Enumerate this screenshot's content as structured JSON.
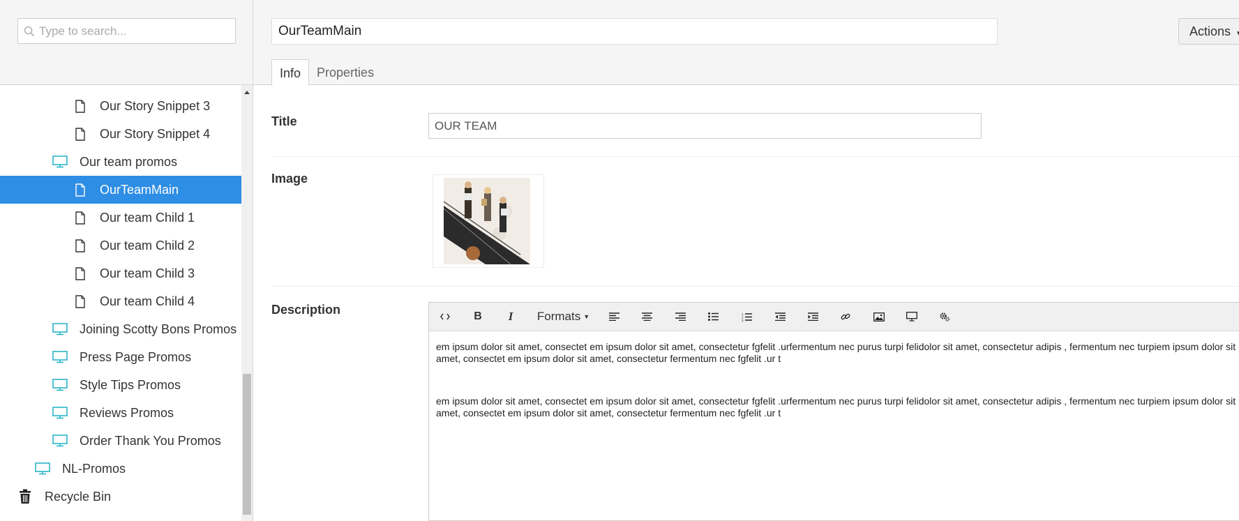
{
  "search": {
    "placeholder": "Type to search..."
  },
  "tree": [
    {
      "label": "Our Story Snippet 3",
      "icon": "document-icon",
      "level": 2
    },
    {
      "label": "Our Story Snippet 4",
      "icon": "document-icon",
      "level": 2
    },
    {
      "label": "Our team promos",
      "icon": "monitor-icon",
      "level": 1
    },
    {
      "label": "OurTeamMain",
      "icon": "document-icon",
      "level": 2,
      "selected": true
    },
    {
      "label": "Our team Child 1",
      "icon": "document-icon",
      "level": 2
    },
    {
      "label": "Our team Child 2",
      "icon": "document-icon",
      "level": 2
    },
    {
      "label": "Our team Child 3",
      "icon": "document-icon",
      "level": 2
    },
    {
      "label": "Our team Child 4",
      "icon": "document-icon",
      "level": 2
    },
    {
      "label": "Joining Scotty Bons Promos",
      "icon": "monitor-icon",
      "level": 1
    },
    {
      "label": "Press Page Promos",
      "icon": "monitor-icon",
      "level": 1
    },
    {
      "label": "Style Tips Promos",
      "icon": "monitor-icon",
      "level": 1
    },
    {
      "label": "Reviews Promos",
      "icon": "monitor-icon",
      "level": 1
    },
    {
      "label": "Order Thank You Promos",
      "icon": "monitor-icon",
      "level": 1
    },
    {
      "label": "NL-Promos",
      "icon": "monitor-icon",
      "level": 0
    },
    {
      "label": "Recycle Bin",
      "icon": "trash-icon",
      "level": -1
    }
  ],
  "header": {
    "node_name": "OurTeamMain",
    "actions_label": "Actions"
  },
  "tabs": [
    {
      "label": "Info",
      "active": true
    },
    {
      "label": "Properties",
      "active": false
    }
  ],
  "fields": {
    "title_label": "Title",
    "title_value": "OUR TEAM",
    "image_label": "Image",
    "description_label": "Description"
  },
  "editor": {
    "formats_label": "Formats",
    "paragraphs": [
      "em ipsum dolor sit amet, consectet em ipsum dolor sit amet, consectetur fgfelit .urfermentum nec purus turpi felidolor sit amet, consectetur adipis , fermentum nec turpiem ipsum dolor sit amet, consectet em ipsum dolor sit amet, consectetur fermentum nec fgfelit .ur t",
      "em ipsum dolor sit amet, consectet em ipsum dolor sit amet, consectetur fgfelit .urfermentum nec purus turpi felidolor sit amet, consectetur adipis , fermentum nec turpiem ipsum dolor sit amet, consectet em ipsum dolor sit amet, consectetur fermentum nec fgfelit .ur t"
    ]
  },
  "colors": {
    "selection": "#2e8de4",
    "monitor_icon": "#2bb5c7",
    "panel_bg": "#f5f5f5"
  }
}
